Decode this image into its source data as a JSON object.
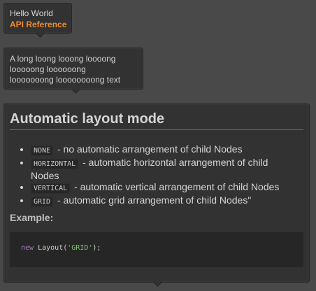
{
  "tooltip_basic": {
    "line1": "Hello World",
    "line2": "API Reference",
    "accent_color": "#f08c2a"
  },
  "tooltip_wrap": {
    "lines": [
      "A long loong looong loooong",
      "looooong loooooong",
      "looooooong loooooooong text"
    ]
  },
  "tooltip_rich": {
    "title": "Automatic layout mode",
    "items": [
      {
        "code": "NONE",
        "text": "- no automatic arrangement of child Nodes"
      },
      {
        "code": "HORIZONTAL",
        "text": "- automatic horizontal arrangement of child Nodes"
      },
      {
        "code": "VERTICAL",
        "text": "- automatic vertical arrangement of child Nodes"
      },
      {
        "code": "GRID",
        "text": "- automatic grid arrangement of child Nodes\""
      }
    ],
    "example_label": "Example:",
    "code": {
      "keyword": "new",
      "call": "Layout(",
      "arg": "'GRID'",
      "close": ");"
    }
  }
}
